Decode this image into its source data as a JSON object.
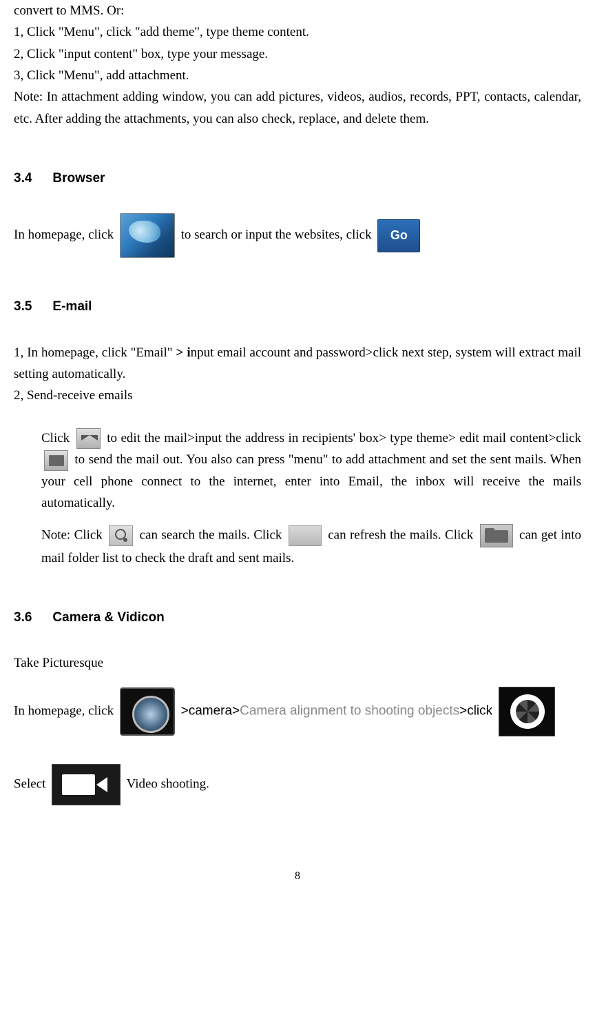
{
  "intro": {
    "line0": "convert to MMS. Or:",
    "line1": "1, Click \"Menu\", click \"add theme\", type theme content.",
    "line2": "2, Click \"input content\" box, type your message.",
    "line3": "3, Click \"Menu\", add attachment.",
    "line4": "Note: In attachment adding window, you can add pictures, videos, audios, records, PPT, contacts, calendar, etc. After adding the attachments, you can also check, replace, and delete them."
  },
  "sec34": {
    "num": "3.4",
    "title": "Browser",
    "text_a": "In homepage, click ",
    "text_b": " to search or input the websites, click ",
    "go_label": "Go"
  },
  "sec35": {
    "num": "3.5",
    "title": "E-mail",
    "p1_a": "1, In homepage, click \"Email\" ",
    "p1_b": "> i",
    "p1_c": "nput email account and password>click next step, system will extract mail setting automatically.",
    "p2": "2, Send-receive emails",
    "i1_a": "Click ",
    "i1_b": " to edit the mail>input the address in recipients' box> type theme> edit mail content>click ",
    "i1_c": " to send the mail out. You also can press \"menu\" to add attachment and set the sent mails. When your cell phone connect to the internet, enter into Email, the inbox will receive the mails automatically.",
    "i2_a": "Note: Click ",
    "i2_b": " can search the mails. Click ",
    "i2_c": " can refresh the mails. Click ",
    "i2_d": " can get into mail folder list to check the draft and sent mails."
  },
  "sec36": {
    "num": "3.6",
    "title": "Camera & Vidicon",
    "p1": "Take Picturesque",
    "line_a": "In homepage, click ",
    "line_b": " >camera>",
    "line_c": "Camera alignment to shooting objects",
    "line_d": ">click ",
    "line2_a": "Select ",
    "line2_b": " Video shooting."
  },
  "page_number": "8"
}
